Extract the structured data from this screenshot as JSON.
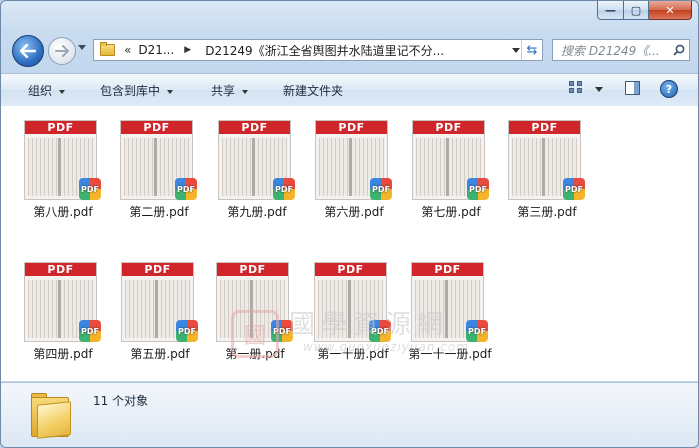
{
  "window": {
    "caption_buttons": {
      "minimize": "—",
      "maximize": "▢",
      "close": "✕"
    }
  },
  "nav": {
    "address": {
      "overflow": "«",
      "crumb1": "D21...",
      "crumb2": "D21249《浙江全省舆图并水陆道里记不分..."
    },
    "search_placeholder": "搜索 D21249《..."
  },
  "toolbar": {
    "organize": "组织",
    "include_library": "包含到库中",
    "share": "共享",
    "new_folder": "新建文件夹"
  },
  "files": [
    {
      "name": "第八册.pdf"
    },
    {
      "name": "第二册.pdf"
    },
    {
      "name": "第九册.pdf"
    },
    {
      "name": "第六册.pdf"
    },
    {
      "name": "第七册.pdf"
    },
    {
      "name": "第三册.pdf"
    },
    {
      "name": "第四册.pdf"
    },
    {
      "name": "第五册.pdf"
    },
    {
      "name": "第一册.pdf"
    },
    {
      "name": "第一十册.pdf"
    },
    {
      "name": "第一十一册.pdf"
    }
  ],
  "thumb_band_label": "PDF",
  "badge_label": "PDF",
  "watermark": {
    "cn": "國學資源網",
    "url": "www.guoxueziyuan.com",
    "seal": "國"
  },
  "details": {
    "count": "11 个对象"
  },
  "colors": {
    "pdf_band": "#d0262b",
    "toolbar_bg": "#dce8f5",
    "close_button": "#c2401f"
  }
}
